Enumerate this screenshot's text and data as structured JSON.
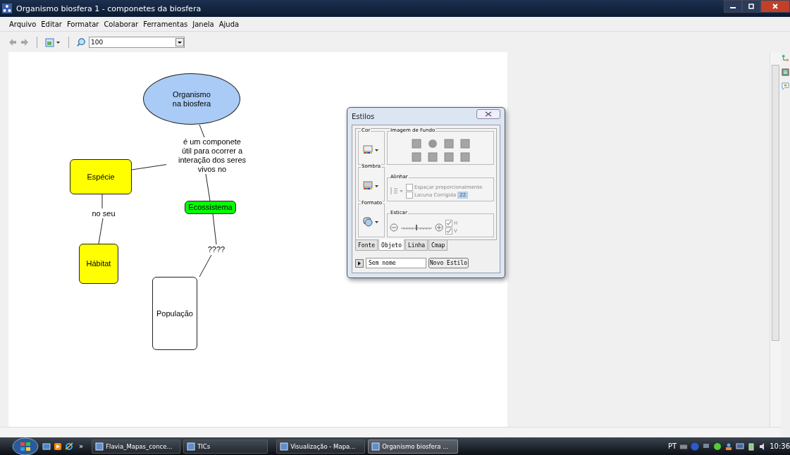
{
  "window": {
    "title": "Organismo biosfera 1 - componetes da biosfera"
  },
  "menu": [
    "Arquivo",
    "Editar",
    "Formatar",
    "Colaborar",
    "Ferramentas",
    "Janela",
    "Ajuda"
  ],
  "toolbar": {
    "zoom": "100"
  },
  "concept_map": {
    "nodes": [
      {
        "kind": "concept",
        "text": "Organismo\nna biosfera",
        "color": "#a9cbf5"
      },
      {
        "kind": "linking",
        "text": "é um componete\nútil para ocorrer a\ninteração dos seres\nvivos no"
      },
      {
        "kind": "concept",
        "text": "Espécie",
        "color": "#ffff00"
      },
      {
        "kind": "concept",
        "text": "Ecossistema",
        "color": "#00ff00"
      },
      {
        "kind": "linking",
        "text": "no seu"
      },
      {
        "kind": "concept",
        "text": "Hábitat",
        "color": "#ffff00"
      },
      {
        "kind": "linking",
        "text": "????"
      },
      {
        "kind": "concept",
        "text": "População",
        "color": "#ffffff"
      }
    ]
  },
  "styles_dialog": {
    "title": "Estilos",
    "color_group": "Cor",
    "shadow_group": "Sombra",
    "format_group": "Formato",
    "background_group": "Imagem de Fundo",
    "align_group": "Alinhar",
    "align_options": [
      {
        "label": "Espaçar proporcionalmente",
        "checked": false
      },
      {
        "label": "Lacuna Corrigida",
        "checked": false
      }
    ],
    "gap_value": "22",
    "stretch_group": "Esticar",
    "stretch_slider": {
      "level": 0.5
    },
    "stretch_options": [
      {
        "label": "H",
        "checked": true
      },
      {
        "label": "V",
        "checked": true
      }
    ],
    "tabs": [
      {
        "label": "Fonte",
        "selected": false
      },
      {
        "label": "Objeto",
        "selected": true
      },
      {
        "label": "Linha",
        "selected": false
      },
      {
        "label": "Cmap",
        "selected": false
      }
    ],
    "style_name": "Sem nome",
    "new_style_button": "Novo Estilo"
  },
  "taskbar": {
    "quick_launch_more": "»",
    "tasks": [
      {
        "label": "Flavia_Mapas_conce...",
        "selected": false
      },
      {
        "label": "TICs",
        "selected": false
      },
      {
        "label": "Visualização - Mapa...",
        "selected": false
      },
      {
        "label": "Organismo biosfera ...",
        "selected": true
      }
    ],
    "language": "PT",
    "clock": "10:36"
  }
}
